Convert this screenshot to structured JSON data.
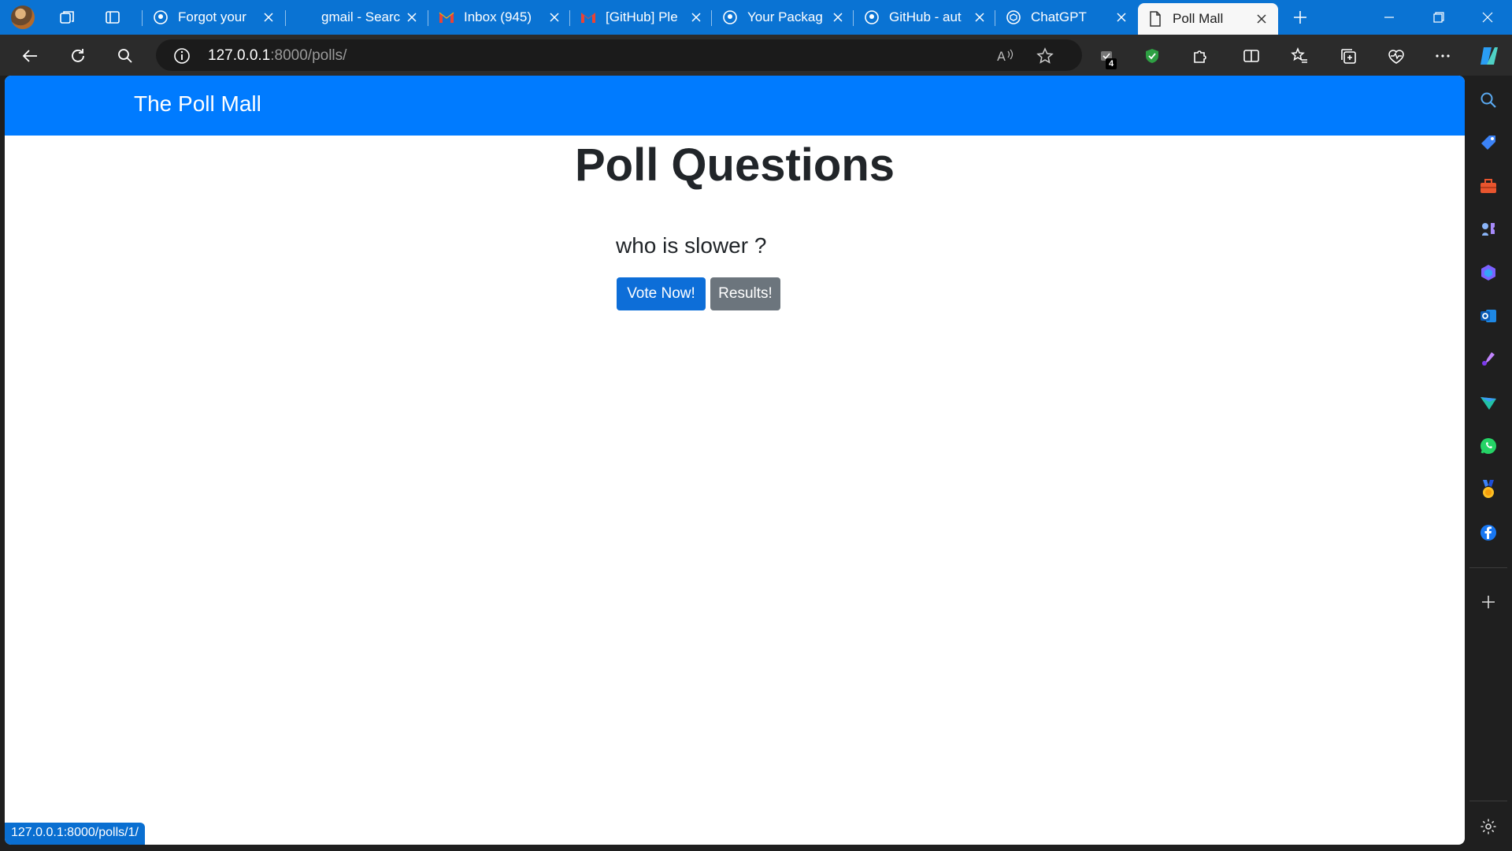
{
  "tabs": [
    {
      "title": "Forgot your",
      "icon": "github-icon"
    },
    {
      "title": "gmail - Searc",
      "icon": "bing-icon"
    },
    {
      "title": "Inbox (945)",
      "icon": "gmail-icon"
    },
    {
      "title": "[GitHub] Ple",
      "icon": "gmail-icon"
    },
    {
      "title": "Your Packag",
      "icon": "github-icon"
    },
    {
      "title": "GitHub - aut",
      "icon": "github-icon"
    },
    {
      "title": "ChatGPT",
      "icon": "chatgpt-icon"
    },
    {
      "title": "Poll Mall",
      "icon": "page-icon"
    }
  ],
  "address_bar": {
    "url_host": "127.0.0.1",
    "url_path": ":8000/polls/"
  },
  "extension_badge": "4",
  "page": {
    "brand": "The Poll Mall",
    "title": "Poll Questions",
    "question": "who is slower ?",
    "vote_button": "Vote Now!",
    "results_button": "Results!"
  },
  "status_bar": "127.0.0.1:8000/polls/1/",
  "colors": {
    "tabstrip": "#0a73d3",
    "navbar": "#007bff",
    "primary_button": "#0d6ed8",
    "secondary_button": "#6c757d"
  }
}
